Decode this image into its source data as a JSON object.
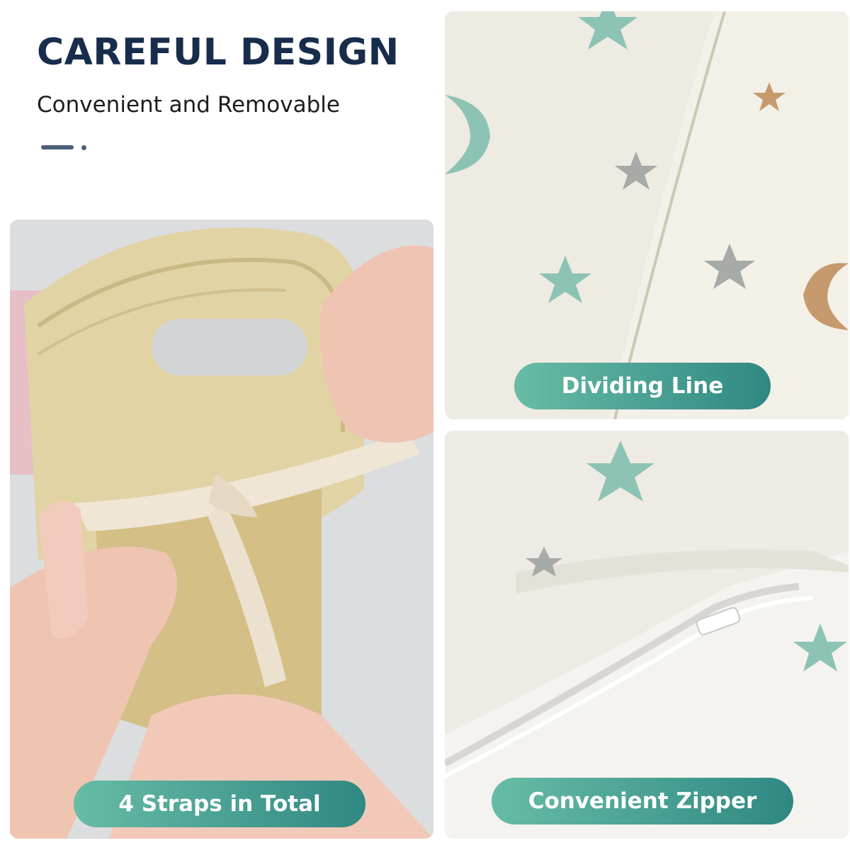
{
  "header": {
    "title": "CAREFUL DESIGN",
    "subtitle": "Convenient and Removable"
  },
  "panels": {
    "straps": {
      "label": "4 Straps in Total"
    },
    "dividing_line": {
      "label": "Dividing Line"
    },
    "zipper": {
      "label": "Convenient Zipper"
    }
  },
  "colors": {
    "title": "#182c4c",
    "pill_start": "#67bca5",
    "pill_end": "#2f8883",
    "star_teal": "#8dc3b5",
    "star_gray": "#a7aaa6",
    "moon_orange": "#c69a6c"
  }
}
